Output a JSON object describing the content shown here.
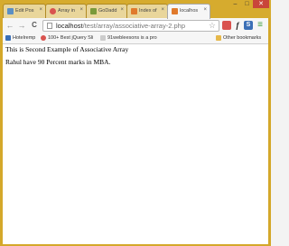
{
  "tabs": [
    {
      "label": "Edit Pos",
      "icon": "wordpress-icon",
      "color": "#5b8fc4"
    },
    {
      "label": "Array in",
      "icon": "heart-icon",
      "color": "#d9534f"
    },
    {
      "label": "GoDadd",
      "icon": "godaddy-icon",
      "color": "#7a9a3a"
    },
    {
      "label": "Index of",
      "icon": "page-icon",
      "color": "#e07a2c"
    },
    {
      "label": "localhos",
      "icon": "page-icon",
      "color": "#e07a2c",
      "active": true
    }
  ],
  "window_controls": {
    "minimize": "–",
    "maximize": "□",
    "close": "✕"
  },
  "toolbar": {
    "back": "←",
    "forward": "→",
    "reload": "C",
    "url_host": "localhost",
    "url_path": "/test/array/associative-array-2.php",
    "star": "☆",
    "menu": "≡"
  },
  "bookmarks": [
    {
      "label": "Hotelremp",
      "color": "#3b6fb6"
    },
    {
      "label": "100+ Best jQuery Sli",
      "color": "#d9534f"
    },
    {
      "label": "91webleesons is a pro",
      "color": "#cccccc"
    }
  ],
  "other_bookmarks": "Other bookmarks",
  "page": {
    "line1": "This is Second Example of Associative Array",
    "line2": "Rahul have 90 Percent marks in MBA."
  },
  "colors": {
    "frame": "#d4a82a",
    "active_tab": "#f6f6f6",
    "close": "#c9453a"
  }
}
